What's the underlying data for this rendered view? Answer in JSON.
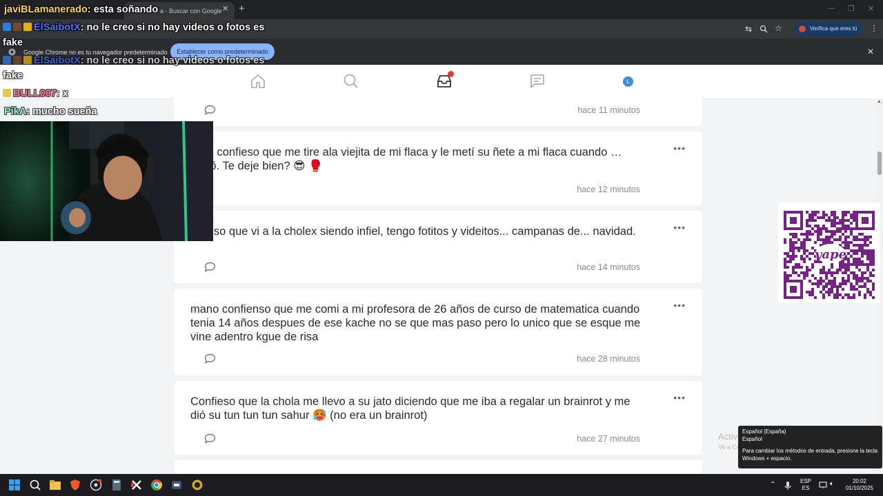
{
  "browser": {
    "tab_title": "Buscar con Google",
    "tab_title_prefix": "a - ",
    "verify_label": "Verifica que eres tú",
    "infobar_text": "Google Chrome no es tu navegador predeterminado",
    "infobar_button": "Establecer como predeterminado"
  },
  "site": {
    "avatar_letter": "L"
  },
  "posts": [
    {
      "text": "…ito confieso que me tire ala viejita de mi flaca y le metí su ñete a mi flaca cuando …nteró. Te deje bien? 😎 🥊",
      "time": "hace 12 minutos"
    },
    {
      "text": "…fieso que vi a la cholex siendo infiel, tengo fotitos y videitos... campanas de... navidad.",
      "time": "hace 14 minutos"
    },
    {
      "text": "mano confienso que me comi a mi profesora de 26 años de curso de matematica cuando tenia 14 años despues de ese kache no se que mas paso pero lo unico que se esque me vine adentro kgue de risa",
      "time": "hace 28 minutos"
    },
    {
      "text": "Confieso que la chola me llevo a su jato diciendo que me iba a regalar un brainrot y me dió su tun tun tun sahur 🥵 (no era un brainrot)",
      "time": "hace 27 minutos"
    }
  ],
  "top_post_time": "hace 11 minutos",
  "chat": [
    {
      "user": "javiBLamanerado",
      "msg": ": esta soñando"
    },
    {
      "user": "ElSaibotX",
      "msg": ": no le creo si no hay videos o fotos es"
    },
    {
      "user": "",
      "msg": "fake"
    },
    {
      "user": "ElSaibotX",
      "msg": ": no le creo si no hay videos o fotos es"
    },
    {
      "user": "",
      "msg": "fake"
    },
    {
      "user": "BULL007",
      "msg": ": x"
    },
    {
      "user": "PikA",
      "msg": ": mucho sueña"
    }
  ],
  "windows": {
    "activate_title": "Activar Windows",
    "activate_sub": "Ve a Configuración para activar Windows.",
    "lang_line1": "Español (España)",
    "lang_line2": "Español",
    "lang_hint": "Para cambiar los métodos de entrada, presione la tecla Windows + espacio.",
    "lang_code": "ESP",
    "lang_sub": "ES",
    "time": "20:02",
    "date": "01/10/2025"
  },
  "qr": {
    "brand": "yape"
  },
  "colors": {
    "accent_red": "#e53935",
    "link_blue": "#8ab4f8",
    "yape_purple": "#742384"
  }
}
